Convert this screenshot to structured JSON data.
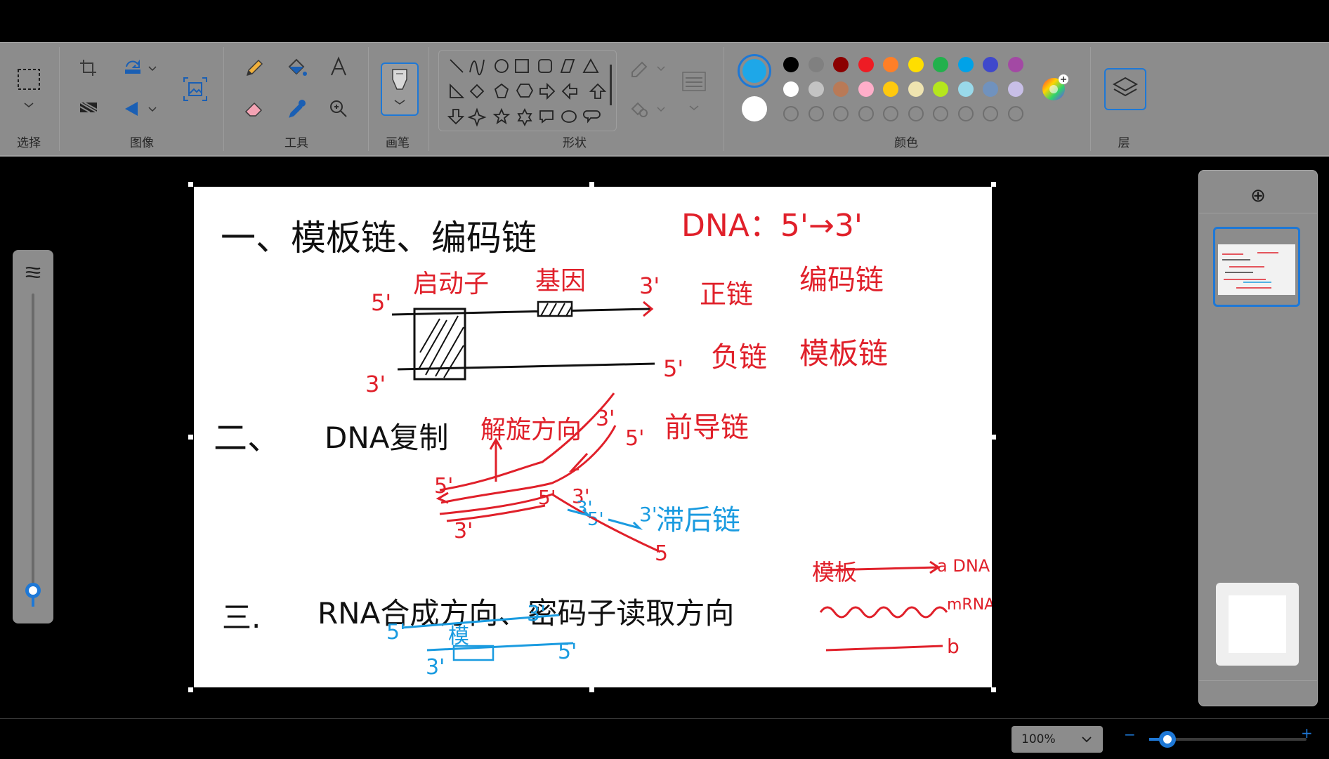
{
  "toolbar": {
    "groups": {
      "select": "选择",
      "image": "图像",
      "tools": "工具",
      "brush": "画笔",
      "shapes": "形状",
      "colors": "颜色",
      "layers": "层"
    },
    "tool_icons": [
      "pencil-icon",
      "fill-icon",
      "text-icon",
      "eraser-icon",
      "color-picker-icon",
      "magnifier-icon"
    ]
  },
  "colors": {
    "primary": "#1ea7e8",
    "secondary": "#ffffff",
    "row1": [
      "#000000",
      "#808080",
      "#8b0000",
      "#ee1c24",
      "#ff7f27",
      "#ffde00",
      "#22b14c",
      "#00a2e8",
      "#3f48cc",
      "#a349a4"
    ],
    "row2": [
      "#ffffff",
      "#c3c3c3",
      "#b97a57",
      "#ffaec9",
      "#ffc90e",
      "#efe4b0",
      "#b5e61d",
      "#99d9ea",
      "#7092be",
      "#c8bfe7"
    ],
    "row3_count": 10
  },
  "canvas_text": {
    "s1_title": "一、模板链、编码链",
    "s1_dna_dir": "DNA：5'→3'",
    "s1_promoter": "启动子",
    "s1_gene": "基因",
    "s1_5a": "5'",
    "s1_3a": "3'",
    "s1_3b": "3'",
    "s1_5b": "5'",
    "s1_pos": "正链",
    "s1_coding": "编码链",
    "s1_neg": "负链",
    "s1_template": "模板链",
    "s2_title": "二、",
    "s2_dna": "DNA复制",
    "s2_unwind": "解旋方向",
    "s2_3": "3'",
    "s2_5": "5'",
    "s2_leading": "前导链",
    "s2_5b": "5'",
    "s2_5c": "5'",
    "s2_3c": "3'",
    "s2_3d": "3'",
    "s2_5d": "5'",
    "s2_3e": "3'",
    "s2_lagging": "滞后链",
    "s2_3f": "3'",
    "s2_5e": "5",
    "s3_title": "三.",
    "s3_rna": "RNA合成方向、密码子读取方向",
    "s3_template": "模板",
    "s3_dna": "a DNA",
    "s3_mrna": "mRNA",
    "s3_b": "b",
    "s3_5a": "5'",
    "s3_3a": "3'",
    "s3_mb": "模",
    "s3_3b": "3'",
    "s3_5b": "5'"
  },
  "status": {
    "zoom": "100%",
    "minus": "−",
    "plus": "+",
    "zoom_level": 0.35
  },
  "right_panel": {
    "add_layer": "⊕"
  }
}
